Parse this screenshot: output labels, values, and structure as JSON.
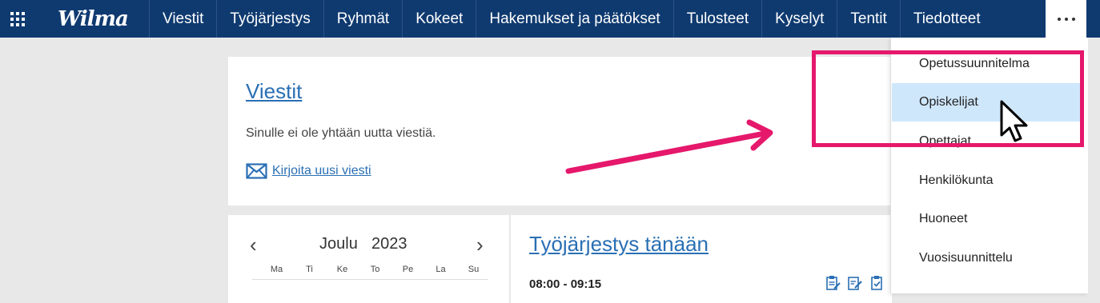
{
  "header": {
    "logo_text": "Wilma",
    "nav_items": [
      "Viestit",
      "Työjärjestys",
      "Ryhmät",
      "Kokeet",
      "Hakemukset ja päätökset",
      "Tulosteet",
      "Kyselyt",
      "Tentit",
      "Tiedotteet"
    ]
  },
  "messages": {
    "title": "Viestit",
    "empty_text": "Sinulle ei ole yhtään uutta viestiä.",
    "compose_label": "Kirjoita uusi viesti"
  },
  "calendar": {
    "month": "Joulu",
    "year": "2023",
    "prev_symbol": "‹",
    "next_symbol": "›",
    "weekdays": [
      "Ma",
      "Ti",
      "Ke",
      "To",
      "Pe",
      "La",
      "Su"
    ]
  },
  "schedule": {
    "title": "Työjärjestys tänään",
    "first_time": "08:00 - 09:15"
  },
  "dropdown": {
    "items": [
      "Opetussuunnitelma",
      "Opiskelijat",
      "Opettajat",
      "Henkilökunta",
      "Huoneet",
      "Vuosisuunnittelu"
    ],
    "active_item": "Opiskelijat"
  },
  "colors": {
    "header_bg": "#0f3a70",
    "link": "#2a6fb4",
    "highlight": "#e5186c",
    "active_item_bg": "#cfe7fb"
  },
  "icons": [
    "apps-grid-icon",
    "more-dots-icon",
    "envelope-icon",
    "clipboard-icon",
    "edit-note-icon",
    "checklist-icon",
    "mouse-pointer-icon",
    "annotation-arrow-icon"
  ]
}
